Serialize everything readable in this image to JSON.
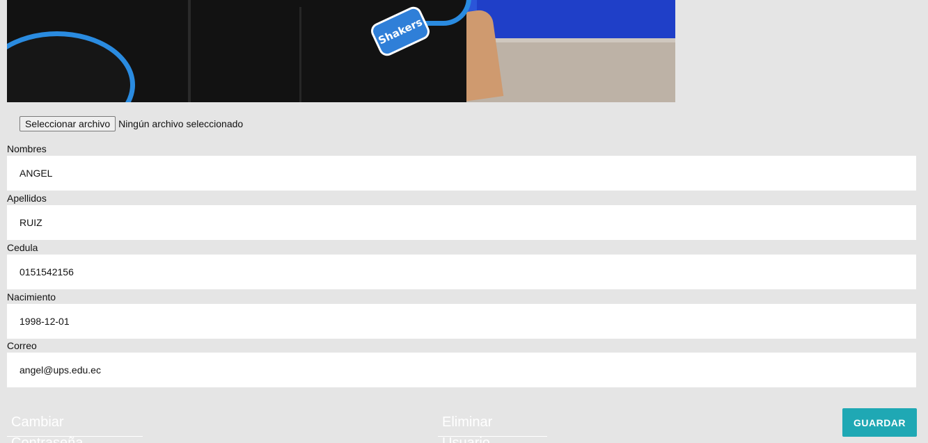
{
  "photo": {
    "logo_text": "Shakers"
  },
  "file_picker": {
    "button_label": "Seleccionar archivo",
    "status": "Ningún archivo seleccionado"
  },
  "fields": [
    {
      "label": "Nombres",
      "value": "ANGEL"
    },
    {
      "label": "Apellidos",
      "value": "RUIZ"
    },
    {
      "label": "Cedula",
      "value": "0151542156"
    },
    {
      "label": "Nacimiento",
      "value": "1998-12-01"
    },
    {
      "label": "Correo",
      "value": "angel@ups.edu.ec"
    }
  ],
  "actions": {
    "change_password": "Cambiar Contraseña",
    "delete_user": "Eliminar Usuario",
    "save": "GUARDAR"
  },
  "colors": {
    "background": "#e5e5e5",
    "input_background": "#ffffff",
    "save_button": "#1fa8b4"
  }
}
